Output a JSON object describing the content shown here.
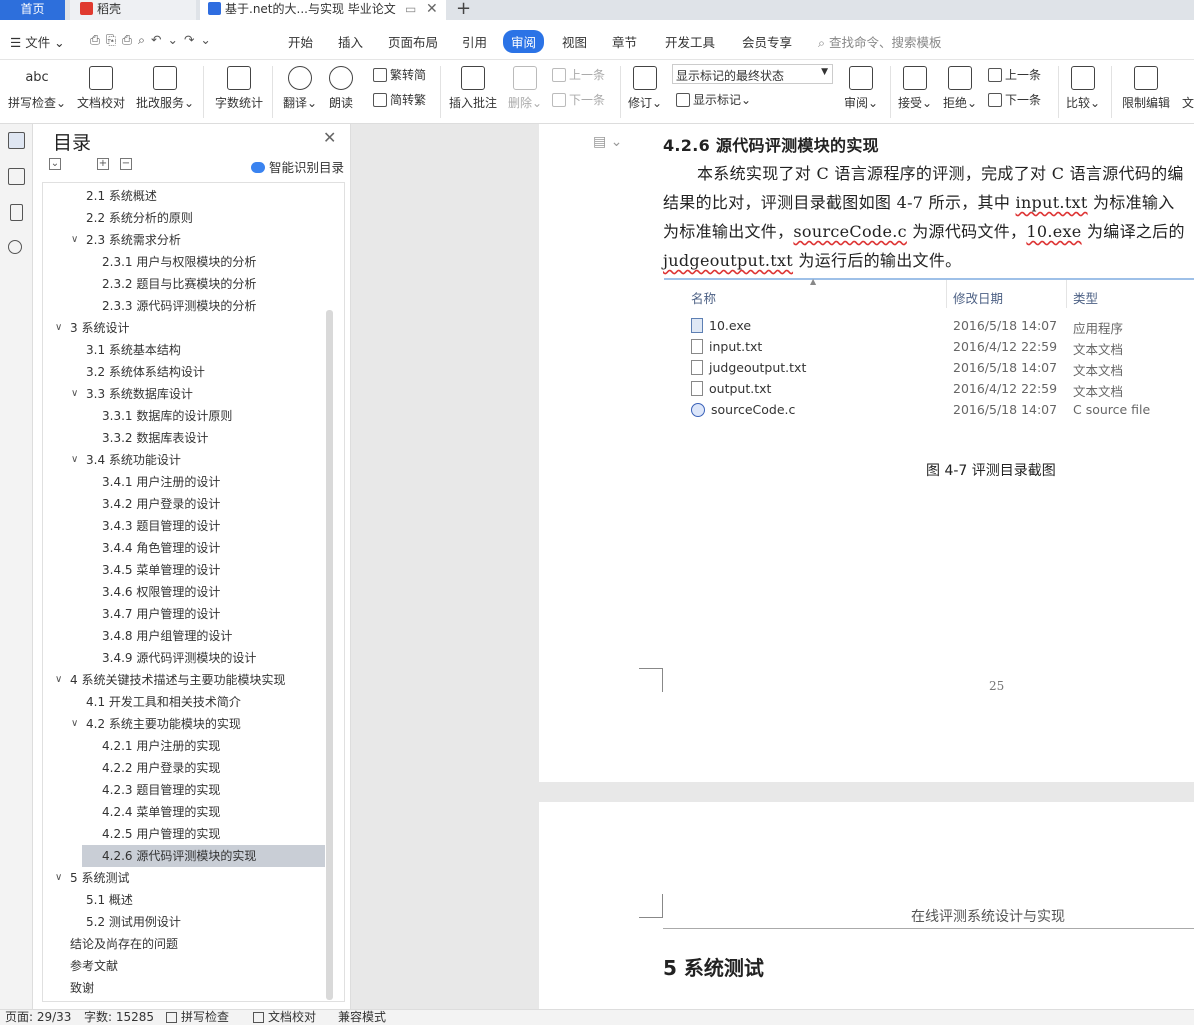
{
  "tabs": {
    "home": "首页",
    "daoke": "稻壳",
    "doc": "基于.net的大...与实现 毕业论文"
  },
  "menu": {
    "file": "文件",
    "items": [
      "开始",
      "插入",
      "页面布局",
      "引用",
      "审阅",
      "视图",
      "章节",
      "开发工具",
      "会员专享"
    ],
    "search": "查找命令、搜索模板"
  },
  "ribbon": {
    "spell": "拼写检查",
    "doccheck": "文档校对",
    "approve": "批改服务",
    "wordcount": "字数统计",
    "translate": "翻译",
    "read": "朗读",
    "trad": "繁转简",
    "simp": "简转繁",
    "insertcomment": "插入批注",
    "delete": "删除",
    "prev_comment": "上一条",
    "next_comment": "下一条",
    "revise": "修订",
    "markup_mode": "显示标记的最终状态",
    "show_markup": "显示标记",
    "review": "审阅",
    "accept": "接受",
    "reject": "拒绝",
    "prev": "上一条",
    "next": "下一条",
    "compare": "比较",
    "restrict": "限制编辑",
    "more": "文"
  },
  "toc": {
    "title": "目录",
    "smart": "智能识别目录",
    "items": [
      "2.1 系统概述",
      "2.2 系统分析的原则",
      "2.3 系统需求分析",
      "2.3.1 用户与权限模块的分析",
      "2.3.2 题目与比赛模块的分析",
      "2.3.3 源代码评测模块的分析",
      "3 系统设计",
      "3.1 系统基本结构",
      "3.2 系统体系结构设计",
      "3.3 系统数据库设计",
      "3.3.1 数据库的设计原则",
      "3.3.2 数据库表设计",
      "3.4 系统功能设计",
      "3.4.1 用户注册的设计",
      "3.4.2 用户登录的设计",
      "3.4.3 题目管理的设计",
      "3.4.4 角色管理的设计",
      "3.4.5 菜单管理的设计",
      "3.4.6 权限管理的设计",
      "3.4.7 用户管理的设计",
      "3.4.8 用户组管理的设计",
      "3.4.9 源代码评测模块的设计",
      "4 系统关键技术描述与主要功能模块实现",
      "4.1 开发工具和相关技术简介",
      "4.2 系统主要功能模块的实现",
      "4.2.1 用户注册的实现",
      "4.2.2 用户登录的实现",
      "4.2.3 题目管理的实现",
      "4.2.4 菜单管理的实现",
      "4.2.5 用户管理的实现",
      "4.2.6 源代码评测模块的实现",
      "5 系统测试",
      "5.1 概述",
      "5.2 测试用例设计",
      "结论及尚存在的问题",
      "参考文献",
      "致谢"
    ]
  },
  "doc": {
    "heading": "4.2.6 源代码评测模块的实现",
    "line1": "本系统实现了对 C 语言源程序的评测，完成了对 C 语言源代码的编",
    "line2a": "结果的比对，评测目录截图如图 4-7 所示，其中 ",
    "line2b": "input.txt",
    "line2c": " 为标准输入",
    "line3a": "为标准输出文件，",
    "line3b": "sourceCode.c",
    "line3c": " 为源代码文件，",
    "line3d": "10.exe",
    "line3e": " 为编译之后的",
    "line4a": "judgeoutput.txt",
    "line4b": " 为运行后的输出文件。",
    "explorer": {
      "col_name": "名称",
      "col_date": "修改日期",
      "col_type": "类型",
      "rows": [
        {
          "name": "10.exe",
          "date": "2016/5/18 14:07",
          "type": "应用程序",
          "icon": "exe-icon"
        },
        {
          "name": "input.txt",
          "date": "2016/4/12 22:59",
          "type": "文本文档",
          "icon": "text-file-icon"
        },
        {
          "name": "judgeoutput.txt",
          "date": "2016/5/18 14:07",
          "type": "文本文档",
          "icon": "text-file-icon"
        },
        {
          "name": "output.txt",
          "date": "2016/4/12 22:59",
          "type": "文本文档",
          "icon": "text-file-icon"
        },
        {
          "name": "sourceCode.c",
          "date": "2016/5/18 14:07",
          "type": "C source file",
          "icon": "c-file-icon"
        }
      ]
    },
    "caption": "图 4-7 评测目录截图",
    "page_number": "25",
    "header2": "在线评测系统设计与实现",
    "chapter5": "5 系统测试"
  },
  "status": {
    "page": "页面: 29/33",
    "words": "字数: 15285",
    "spell": "拼写检查",
    "doccheck": "文档校对",
    "compat": "兼容模式"
  }
}
